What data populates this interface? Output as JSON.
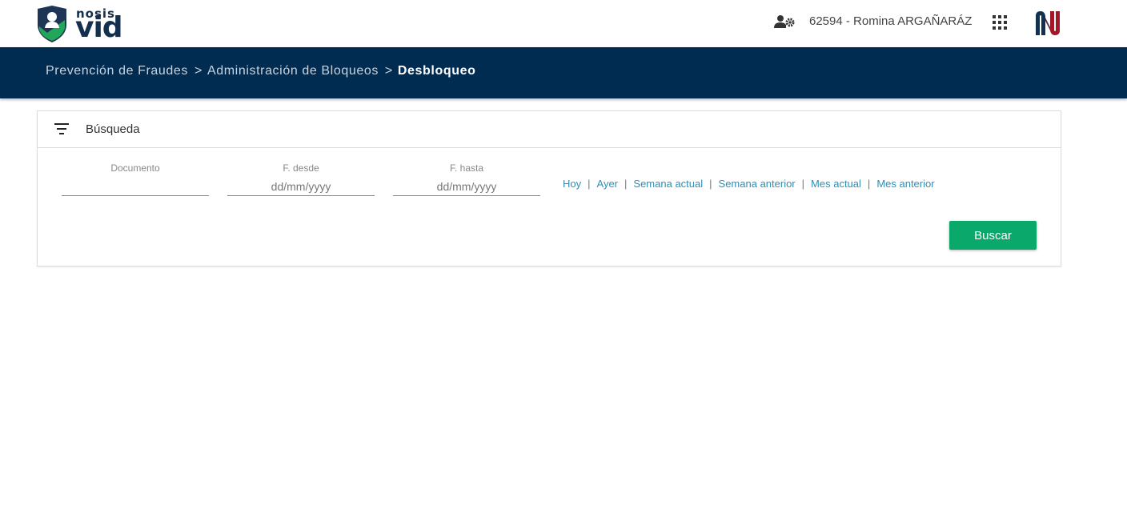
{
  "header": {
    "brand_small": "nosis",
    "brand_big": "vid",
    "user_label": "62594 - Romina ARGAÑARÁZ",
    "icons": {
      "user_settings": "user-gear-icon",
      "apps": "apps-grid-icon",
      "nu_logo": "nu-logo"
    }
  },
  "breadcrumb": {
    "items": [
      "Prevención de Fraudes",
      "Administración de Bloqueos"
    ],
    "current": "Desbloqueo",
    "separator": ">"
  },
  "search": {
    "title": "Búsqueda",
    "fields": {
      "documento": {
        "label": "Documento",
        "value": "",
        "placeholder": ""
      },
      "desde": {
        "label": "F. desde",
        "value": "",
        "placeholder": "dd/mm/yyyy"
      },
      "hasta": {
        "label": "F. hasta",
        "value": "",
        "placeholder": "dd/mm/yyyy"
      }
    },
    "quick_ranges": [
      "Hoy",
      "Ayer",
      "Semana actual",
      "Semana anterior",
      "Mes actual",
      "Mes anterior"
    ],
    "quick_separator": "|",
    "submit_label": "Buscar"
  },
  "colors": {
    "navbar": "#002c52",
    "primary_button": "#0aa86a",
    "link": "#2e8fb5",
    "brand_green": "#22a65a",
    "brand_navy": "#14304f",
    "nu_red": "#a3162a"
  }
}
